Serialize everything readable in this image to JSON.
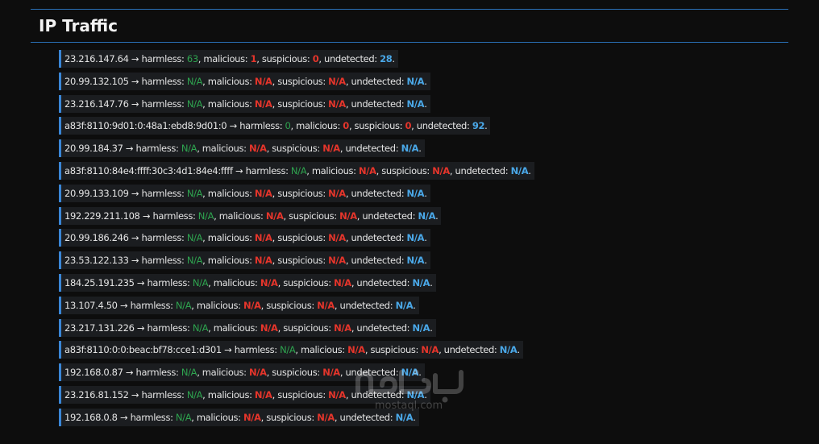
{
  "header": {
    "title": "IP Traffic"
  },
  "labels": {
    "arrow": " → ",
    "harmless": "harmless: ",
    "malicious": ", malicious: ",
    "suspicious": ", suspicious: ",
    "undetected": ", undetected: ",
    "end": "."
  },
  "colors": {
    "harmless": "#2ea44f",
    "malicious": "#e5352b",
    "suspicious": "#e5352b",
    "undetected": "#4aa8e8",
    "accent": "#3a86d6"
  },
  "rows": [
    {
      "ip": "23.216.147.64",
      "harmless": "63",
      "malicious": "1",
      "suspicious": "0",
      "undetected": "28"
    },
    {
      "ip": "20.99.132.105",
      "harmless": "N/A",
      "malicious": "N/A",
      "suspicious": "N/A",
      "undetected": "N/A"
    },
    {
      "ip": "23.216.147.76",
      "harmless": "N/A",
      "malicious": "N/A",
      "suspicious": "N/A",
      "undetected": "N/A"
    },
    {
      "ip": "a83f:8110:9d01:0:48a1:ebd8:9d01:0",
      "harmless": "0",
      "malicious": "0",
      "suspicious": "0",
      "undetected": "92"
    },
    {
      "ip": "20.99.184.37",
      "harmless": "N/A",
      "malicious": "N/A",
      "suspicious": "N/A",
      "undetected": "N/A"
    },
    {
      "ip": "a83f:8110:84e4:ffff:30c3:4d1:84e4:ffff",
      "harmless": "N/A",
      "malicious": "N/A",
      "suspicious": "N/A",
      "undetected": "N/A"
    },
    {
      "ip": "20.99.133.109",
      "harmless": "N/A",
      "malicious": "N/A",
      "suspicious": "N/A",
      "undetected": "N/A"
    },
    {
      "ip": "192.229.211.108",
      "harmless": "N/A",
      "malicious": "N/A",
      "suspicious": "N/A",
      "undetected": "N/A"
    },
    {
      "ip": "20.99.186.246",
      "harmless": "N/A",
      "malicious": "N/A",
      "suspicious": "N/A",
      "undetected": "N/A"
    },
    {
      "ip": "23.53.122.133",
      "harmless": "N/A",
      "malicious": "N/A",
      "suspicious": "N/A",
      "undetected": "N/A"
    },
    {
      "ip": "184.25.191.235",
      "harmless": "N/A",
      "malicious": "N/A",
      "suspicious": "N/A",
      "undetected": "N/A"
    },
    {
      "ip": "13.107.4.50",
      "harmless": "N/A",
      "malicious": "N/A",
      "suspicious": "N/A",
      "undetected": "N/A"
    },
    {
      "ip": "23.217.131.226",
      "harmless": "N/A",
      "malicious": "N/A",
      "suspicious": "N/A",
      "undetected": "N/A"
    },
    {
      "ip": "a83f:8110:0:0:beac:bf78:cce1:d301",
      "harmless": "N/A",
      "malicious": "N/A",
      "suspicious": "N/A",
      "undetected": "N/A"
    },
    {
      "ip": "192.168.0.87",
      "harmless": "N/A",
      "malicious": "N/A",
      "suspicious": "N/A",
      "undetected": "N/A"
    },
    {
      "ip": "23.216.81.152",
      "harmless": "N/A",
      "malicious": "N/A",
      "suspicious": "N/A",
      "undetected": "N/A"
    },
    {
      "ip": "192.168.0.8",
      "harmless": "N/A",
      "malicious": "N/A",
      "suspicious": "N/A",
      "undetected": "N/A"
    }
  ],
  "watermark": {
    "text": "mostaql.com"
  }
}
